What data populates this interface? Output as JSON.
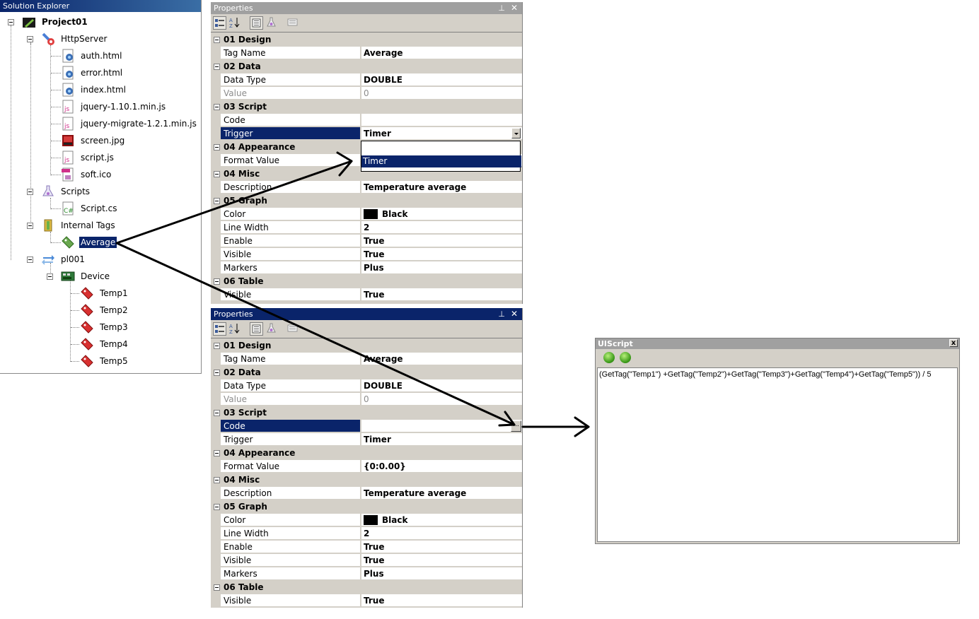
{
  "solution_explorer": {
    "title": "Solution Explorer",
    "items": [
      {
        "label": "Project01",
        "icon": "project-icon"
      },
      {
        "label": "HttpServer",
        "icon": "http-server-icon"
      },
      {
        "label": "auth.html",
        "icon": "html-file-icon"
      },
      {
        "label": "error.html",
        "icon": "html-file-icon"
      },
      {
        "label": "index.html",
        "icon": "html-file-icon"
      },
      {
        "label": "jquery-1.10.1.min.js",
        "icon": "js-file-icon"
      },
      {
        "label": "jquery-migrate-1.2.1.min.js",
        "icon": "js-file-icon"
      },
      {
        "label": "screen.jpg",
        "icon": "image-file-icon"
      },
      {
        "label": "script.js",
        "icon": "js-file-icon"
      },
      {
        "label": "soft.ico",
        "icon": "ico-file-icon"
      },
      {
        "label": "Scripts",
        "icon": "scripts-folder-icon"
      },
      {
        "label": "Script.cs",
        "icon": "csharp-file-icon"
      },
      {
        "label": "Internal Tags",
        "icon": "internal-tags-icon"
      },
      {
        "label": "Average",
        "icon": "tag-icon"
      },
      {
        "label": "pl001",
        "icon": "plc-connection-icon"
      },
      {
        "label": "Device",
        "icon": "device-icon"
      },
      {
        "label": "Temp1",
        "icon": "red-tag-icon"
      },
      {
        "label": "Temp2",
        "icon": "red-tag-icon"
      },
      {
        "label": "Temp3",
        "icon": "red-tag-icon"
      },
      {
        "label": "Temp4",
        "icon": "red-tag-icon"
      },
      {
        "label": "Temp5",
        "icon": "red-tag-icon"
      }
    ]
  },
  "properties_top": {
    "title": "Properties",
    "pin": "⊥",
    "close": "✕",
    "rows": [
      {
        "cat": "01 Design"
      },
      {
        "name": "Tag Name",
        "value": "Average"
      },
      {
        "cat": "02 Data"
      },
      {
        "name": "Data Type",
        "value": "DOUBLE"
      },
      {
        "name": "Value",
        "value": "0"
      },
      {
        "cat": "03 Script"
      },
      {
        "name": "Code",
        "value": ""
      },
      {
        "name": "Trigger",
        "value": "Timer"
      },
      {
        "cat": "04 Appearance"
      },
      {
        "name": "Format Value",
        "value": ""
      },
      {
        "cat": "04 Misc"
      },
      {
        "name": "Description",
        "value": "Temperature average"
      },
      {
        "cat": "05 Graph"
      },
      {
        "name": "Color",
        "value": "Black"
      },
      {
        "name": "Line Width",
        "value": "2"
      },
      {
        "name": "Enable",
        "value": "True"
      },
      {
        "name": "Visible",
        "value": "True"
      },
      {
        "name": "Markers",
        "value": "Plus"
      },
      {
        "cat": "06 Table"
      },
      {
        "name": "Visible",
        "value": "True"
      }
    ],
    "dropdown_options": [
      "",
      "Timer"
    ]
  },
  "properties_bottom": {
    "title": "Properties",
    "pin": "⊥",
    "close": "✕",
    "rows": [
      {
        "cat": "01 Design"
      },
      {
        "name": "Tag Name",
        "value": "Average"
      },
      {
        "cat": "02 Data"
      },
      {
        "name": "Data Type",
        "value": "DOUBLE"
      },
      {
        "name": "Value",
        "value": "0"
      },
      {
        "cat": "03 Script"
      },
      {
        "name": "Code",
        "value": ""
      },
      {
        "name": "Trigger",
        "value": "Timer"
      },
      {
        "cat": "04 Appearance"
      },
      {
        "name": "Format Value",
        "value": "{0:0.00}"
      },
      {
        "cat": "04 Misc"
      },
      {
        "name": "Description",
        "value": "Temperature average"
      },
      {
        "cat": "05 Graph"
      },
      {
        "name": "Color",
        "value": "Black"
      },
      {
        "name": "Line Width",
        "value": "2"
      },
      {
        "name": "Enable",
        "value": "True"
      },
      {
        "name": "Visible",
        "value": "True"
      },
      {
        "name": "Markers",
        "value": "Plus"
      },
      {
        "cat": "06 Table"
      },
      {
        "name": "Visible",
        "value": "True"
      }
    ],
    "ellipsis": "..."
  },
  "uiscript": {
    "title": "UIScript",
    "close": "x",
    "code": "(GetTag(\"Temp1\") +GetTag(\"Temp2\")+GetTag(\"Temp3\")+GetTag(\"Temp4\")+GetTag(\"Temp5\")) / 5"
  },
  "colors": {
    "selection": "#0a246a",
    "panel_bg": "#d4d0c8",
    "inactive_title": "#a0a0a0",
    "swatch_black": "#000000"
  }
}
